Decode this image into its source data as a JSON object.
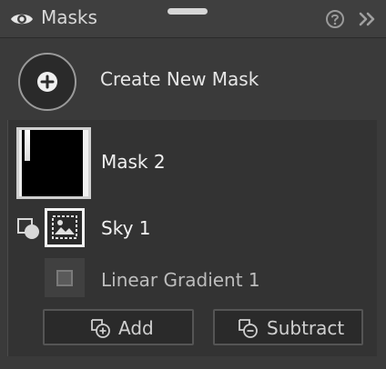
{
  "header": {
    "title": "Masks",
    "visibility_icon": "eye-icon",
    "help_icon": "question-circle-icon",
    "collapse_icon": "double-chevron-right-icon"
  },
  "create": {
    "label": "Create New Mask",
    "icon": "plus-icon"
  },
  "masks": [
    {
      "name": "Mask 2",
      "components": [
        {
          "name": "Sky 1",
          "icon": "sky-icon",
          "mode_icon": "intersect-icon"
        },
        {
          "name": "Linear Gradient 1",
          "icon": "linear-gradient-icon"
        }
      ]
    }
  ],
  "actions": {
    "add_label": "Add",
    "subtract_label": "Subtract"
  },
  "colors": {
    "panel_bg": "#3a3a3a",
    "list_bg": "#333333",
    "selected_border": "#f2f2f2",
    "text": "#e8e8e8",
    "muted_text": "#bdbdbd"
  }
}
